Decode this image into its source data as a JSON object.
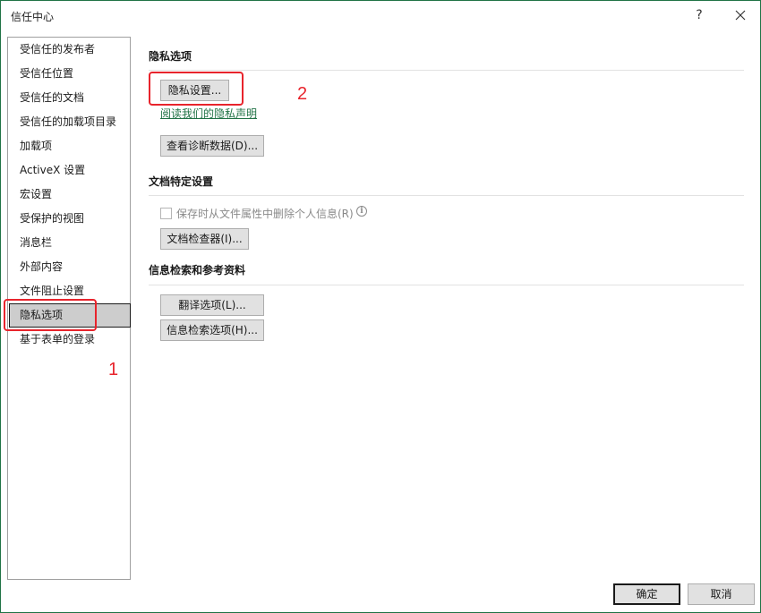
{
  "window": {
    "title": "信任中心",
    "help_glyph": "?",
    "close_icon": "close-icon"
  },
  "sidebar": {
    "items": [
      {
        "label": "受信任的发布者",
        "selected": false
      },
      {
        "label": "受信任位置",
        "selected": false
      },
      {
        "label": "受信任的文档",
        "selected": false
      },
      {
        "label": "受信任的加载项目录",
        "selected": false
      },
      {
        "label": "加载项",
        "selected": false
      },
      {
        "label": "ActiveX 设置",
        "selected": false
      },
      {
        "label": "宏设置",
        "selected": false
      },
      {
        "label": "受保护的视图",
        "selected": false
      },
      {
        "label": "消息栏",
        "selected": false
      },
      {
        "label": "外部内容",
        "selected": false
      },
      {
        "label": "文件阻止设置",
        "selected": false
      },
      {
        "label": "隐私选项",
        "selected": true
      },
      {
        "label": "基于表单的登录",
        "selected": false
      }
    ]
  },
  "privacy": {
    "title": "隐私选项",
    "privacy_settings_button": "隐私设置...",
    "privacy_statement_link": "阅读我们的隐私声明",
    "diagnostic_data_button": "查看诊断数据(D)..."
  },
  "document_specific": {
    "title": "文档特定设置",
    "remove_personal_info_checkbox": "保存时从文件属性中删除个人信息(R)",
    "remove_personal_info_checked": false,
    "info_glyph": "i",
    "document_inspector_button": "文档检查器(I)..."
  },
  "research": {
    "title": "信息检索和参考资料",
    "translation_options_button": "翻译选项(L)...",
    "research_options_button": "信息检索选项(H)..."
  },
  "footer": {
    "ok_button": "确定",
    "cancel_button": "取消"
  },
  "annotations": {
    "step1": "1",
    "step2": "2",
    "color": "#e8242c"
  },
  "colors": {
    "accent": "#217346",
    "selected_background": "#cdcdcd",
    "button_face": "#e1e1e1"
  }
}
